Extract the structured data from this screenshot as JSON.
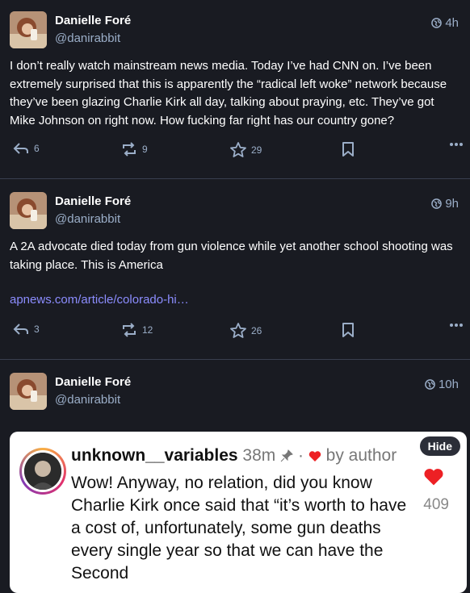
{
  "posts": [
    {
      "name": "Danielle Foré",
      "handle": "@danirabbit",
      "time": "4h",
      "text": "I don’t really watch mainstream news media. Today I’ve had CNN on. I’ve been extremely surprised that this is apparently the “radical left woke” network because they’ve been glazing Charlie Kirk all day, talking about praying, etc. They’ve got Mike Johnson on right now. How fucking far right has our country gone?",
      "replies": "6",
      "boosts": "9",
      "favourites": "29"
    },
    {
      "name": "Danielle Foré",
      "handle": "@danirabbit",
      "time": "9h",
      "text": "A 2A advocate died today from gun violence while yet another school shooting was taking place. This is America",
      "link": "apnews.com/article/colorado-hi…",
      "replies": "3",
      "boosts": "12",
      "favourites": "26"
    },
    {
      "name": "Danielle Foré",
      "handle": "@danirabbit",
      "time": "10h",
      "media": {
        "hide_label": "Hide",
        "username": "unknown__variables",
        "age": "38m",
        "by_author": "by author",
        "text": "Wow! Anyway, no relation, did you know Charlie Kirk once said that “it’s worth to have a cost of, unfortunately, some gun deaths every single year so that we can have the Second",
        "likes": "409"
      }
    }
  ],
  "icons": {
    "reply": "reply-icon",
    "boost": "boost-icon",
    "favourite": "star-icon",
    "bookmark": "bookmark-icon",
    "more": "more-icon",
    "visibility": "globe-icon"
  },
  "colors": {
    "background": "#191b22",
    "muted": "#9baec8",
    "link": "#8c8dff",
    "divider": "#393f4f",
    "heart": "#ed2024"
  }
}
